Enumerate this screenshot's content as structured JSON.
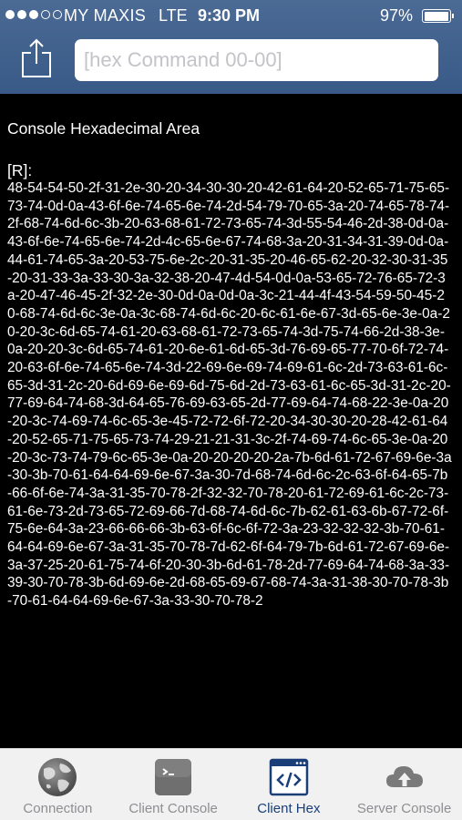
{
  "status_bar": {
    "carrier": "MY MAXIS",
    "network": "LTE",
    "time": "9:30 PM",
    "battery_percent": "97%",
    "battery_level": 0.97,
    "signal_bars_filled": 3,
    "signal_bars_total": 5
  },
  "toolbar": {
    "share_icon": "share-icon",
    "command_input": {
      "placeholder": "[hex Command 00-00]",
      "value": ""
    }
  },
  "console": {
    "title": "Console Hexadecimal Area",
    "rx_label": "[R]:",
    "hex": "48-54-54-50-2f-31-2e-30-20-34-30-30-20-42-61-64-20-52-65-71-75-65-73-74-0d-0a-43-6f-6e-74-65-6e-74-2d-54-79-70-65-3a-20-74-65-78-74-2f-68-74-6d-6c-3b-20-63-68-61-72-73-65-74-3d-55-54-46-2d-38-0d-0a-43-6f-6e-74-65-6e-74-2d-4c-65-6e-67-74-68-3a-20-31-34-31-39-0d-0a-44-61-74-65-3a-20-53-75-6e-2c-20-31-35-20-46-65-62-20-32-30-31-35-20-31-33-3a-33-30-3a-32-38-20-47-4d-54-0d-0a-53-65-72-76-65-72-3a-20-47-46-45-2f-32-2e-30-0d-0a-0d-0a-3c-21-44-4f-43-54-59-50-45-20-68-74-6d-6c-3e-0a-3c-68-74-6d-6c-20-6c-61-6e-67-3d-65-6e-3e-0a-20-20-3c-6d-65-74-61-20-63-68-61-72-73-65-74-3d-75-74-66-2d-38-3e-0a-20-20-3c-6d-65-74-61-20-6e-61-6d-65-3d-76-69-65-77-70-6f-72-74-20-63-6f-6e-74-65-6e-74-3d-22-69-6e-69-74-69-61-6c-2d-73-63-61-6c-65-3d-31-2c-20-6d-69-6e-69-6d-75-6d-2d-73-63-61-6c-65-3d-31-2c-20-77-69-64-74-68-3d-64-65-76-69-63-65-2d-77-69-64-74-68-22-3e-0a-20-20-3c-74-69-74-6c-65-3e-45-72-72-6f-72-20-34-30-30-20-28-42-61-64-20-52-65-71-75-65-73-74-29-21-21-31-3c-2f-74-69-74-6c-65-3e-0a-20-20-3c-73-74-79-6c-65-3e-0a-20-20-20-20-2a-7b-6d-61-72-67-69-6e-3a-30-3b-70-61-64-64-69-6e-67-3a-30-7d-68-74-6d-6c-2c-63-6f-64-65-7b-66-6f-6e-74-3a-31-35-70-78-2f-32-32-70-78-20-61-72-69-61-6c-2c-73-61-6e-73-2d-73-65-72-69-66-7d-68-74-6d-6c-7b-62-61-63-6b-67-72-6f-75-6e-64-3a-23-66-66-66-3b-63-6f-6c-6f-72-3a-23-32-32-32-3b-70-61-64-64-69-6e-67-3a-31-35-70-78-7d-62-6f-64-79-7b-6d-61-72-67-69-6e-3a-37-25-20-61-75-74-6f-20-30-3b-6d-61-78-2d-77-69-64-74-68-3a-33-39-30-70-78-3b-6d-69-6e-2d-68-65-69-67-68-74-3a-31-38-30-70-78-3b-70-61-64-64-69-6e-67-3a-33-30-70-78-2"
  },
  "tabs": [
    {
      "label": "Connection",
      "icon": "globe-icon",
      "active": false
    },
    {
      "label": "Client Console",
      "icon": "terminal-icon",
      "active": false
    },
    {
      "label": "Client Hex",
      "icon": "code-icon",
      "active": true
    },
    {
      "label": "Server Console",
      "icon": "cloud-icon",
      "active": false
    }
  ],
  "colors": {
    "nav_bar": "#3f5f8c",
    "console_background": "#000000",
    "console_text": "#ffffff",
    "tab_active": "#1a3f78",
    "tab_inactive": "#8e8e93"
  }
}
